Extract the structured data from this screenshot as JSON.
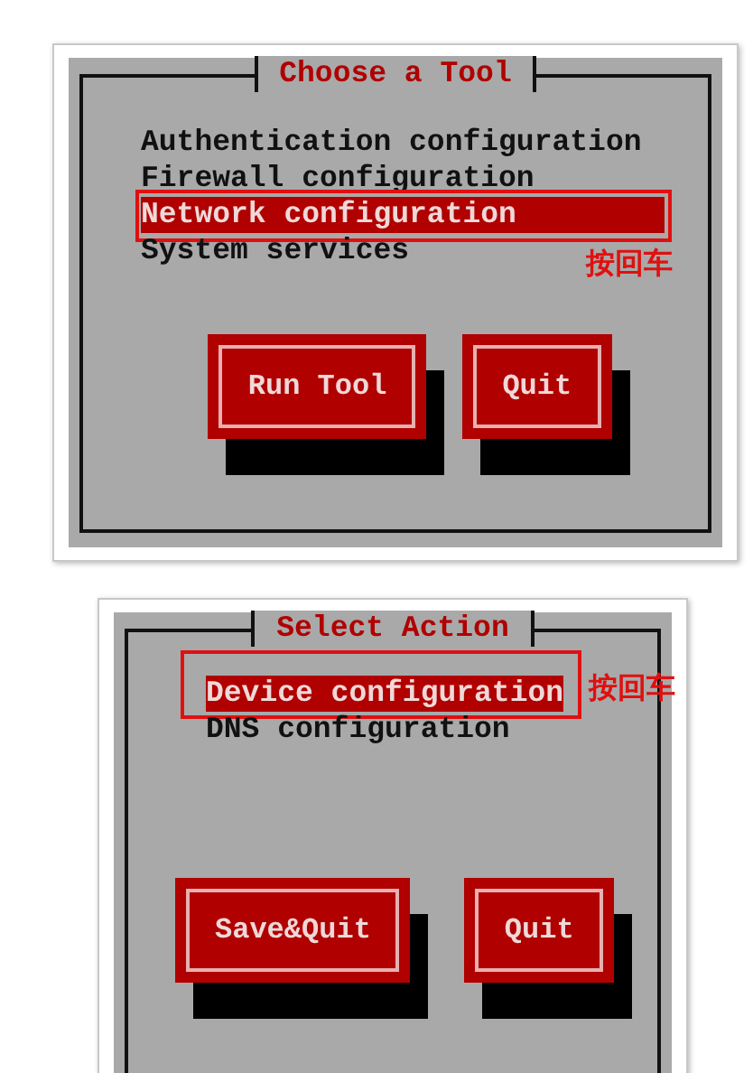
{
  "dialogs": [
    {
      "title": "Choose a Tool",
      "items": [
        {
          "label": "Authentication configuration",
          "selected": false
        },
        {
          "label": "Firewall configuration",
          "selected": false
        },
        {
          "label": "Network configuration",
          "selected": true
        },
        {
          "label": "System services",
          "selected": false
        }
      ],
      "annotation": {
        "text": "按回车",
        "beside": false
      },
      "buttons": [
        "Run Tool",
        "Quit"
      ]
    },
    {
      "title": "Select Action",
      "items": [
        {
          "label": "Device configuration",
          "selected": true
        },
        {
          "label": "DNS configuration",
          "selected": false
        }
      ],
      "annotation": {
        "text": "按回车",
        "beside": true
      },
      "buttons": [
        "Save&Quit",
        "Quit"
      ]
    }
  ]
}
